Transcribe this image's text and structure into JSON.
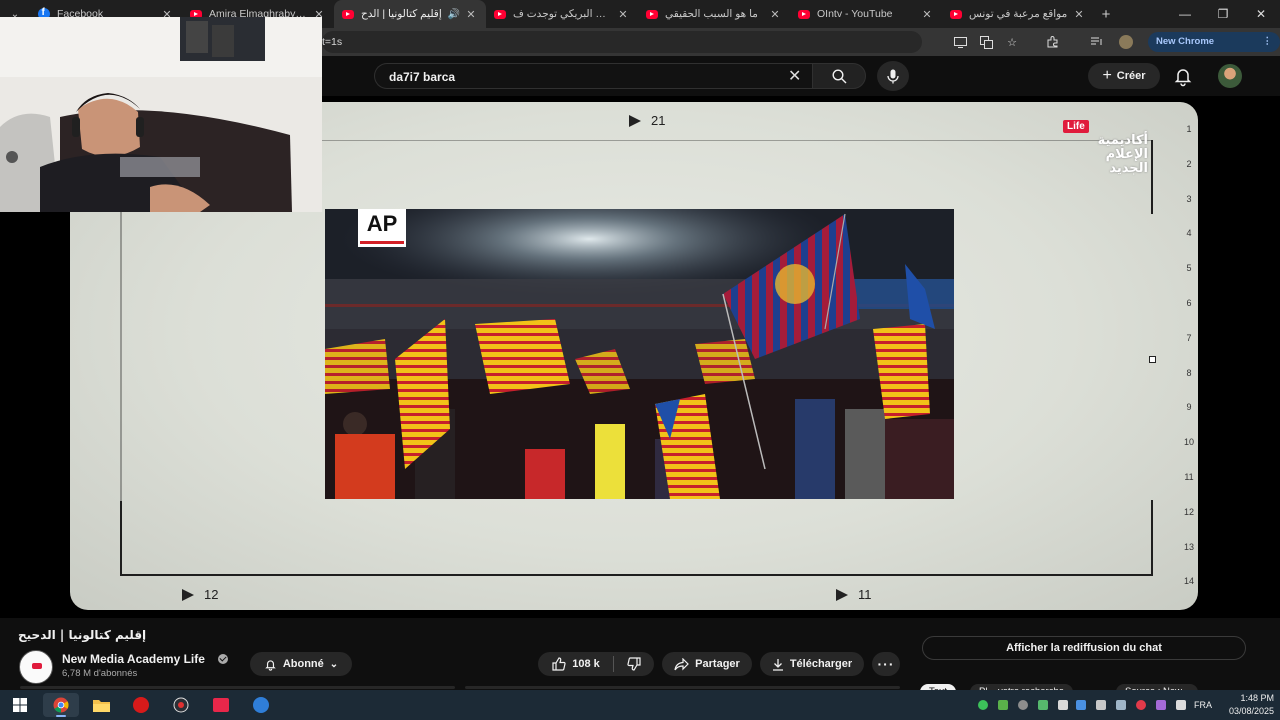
{
  "browser": {
    "tabs": [
      {
        "label": "Facebook",
        "icon": "facebook-icon",
        "active": false
      },
      {
        "label": "Amira Elmaghraby - Y",
        "icon": "youtube-icon",
        "active": false
      },
      {
        "label": "إقليم كتالونيا | الدح",
        "icon": "youtube-icon",
        "active": true
      },
      {
        "label": "بلال البريكي توجدت ف",
        "icon": "youtube-icon",
        "active": false
      },
      {
        "label": "ما هو السبب الحقيقي",
        "icon": "youtube-icon",
        "active": false
      },
      {
        "label": "OIntv - YouTube",
        "icon": "youtube-icon",
        "active": false
      },
      {
        "label": "مواقع مرعبة في تونس",
        "icon": "youtube-icon",
        "active": false
      }
    ],
    "url_fragment": "t=1s",
    "new_chrome_label": "New Chrome available"
  },
  "youtube": {
    "search_query": "da7i7 barca",
    "create_label": "Créer"
  },
  "video_frame": {
    "top_counter": "21",
    "bottom_left_counter": "12",
    "bottom_right_counter": "11",
    "ruler_numbers": [
      "1",
      "2",
      "3",
      "4",
      "5",
      "6",
      "7",
      "8",
      "9",
      "10",
      "11",
      "12",
      "13",
      "14"
    ],
    "life_badge": "Life",
    "academy_lines": [
      "أكاديمية",
      "الإعلام",
      "الجديد"
    ],
    "photo_watermark": "AP"
  },
  "video_info": {
    "title": "إقليم كتالونيا | الدحيح",
    "channel_name": "New Media Academy Life",
    "subscribers": "6,78 M d'abonnés",
    "subscribed_label": "Abonné",
    "like_count": "108 k",
    "share_label": "Partager",
    "download_label": "Télécharger",
    "chat_replay_label": "Afficher la rediffusion du chat",
    "chips": [
      "Tout",
      "Pl... votre recherche",
      "Source : New..."
    ]
  },
  "taskbar": {
    "language": "FRA",
    "time": "1:48 PM",
    "date": "03/08/2025"
  },
  "colors": {
    "yt_background": "#0f0f0f",
    "chrome_tabstrip": "#1f1f1f",
    "chrome_toolbar": "#353535",
    "youtube_red": "#ff0033",
    "taskbar": "#1c2a36",
    "life_badge_red": "#e01b3c"
  }
}
